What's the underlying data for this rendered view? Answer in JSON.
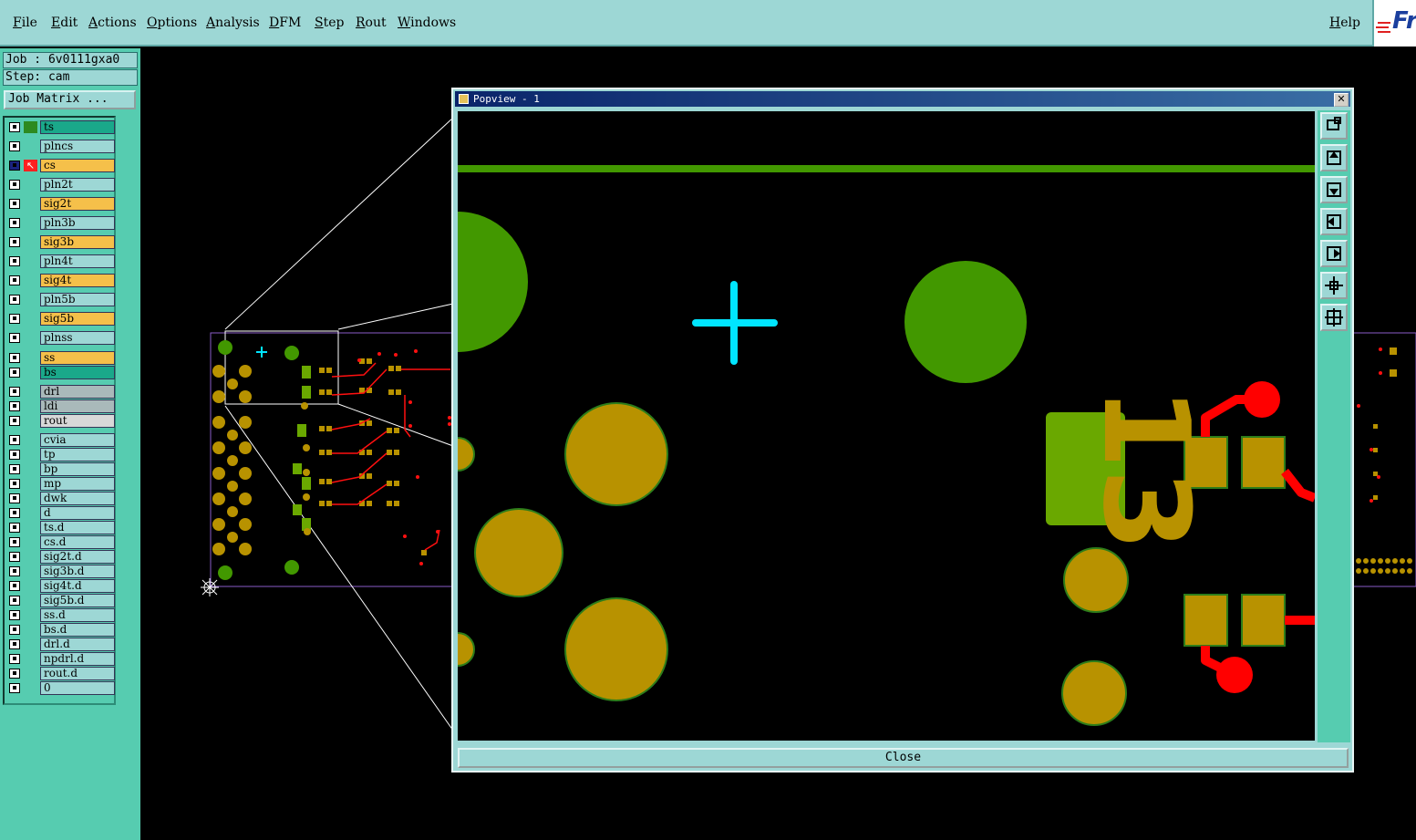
{
  "menubar": {
    "items": [
      "File",
      "Edit",
      "Actions",
      "Options",
      "Analysis",
      "DFM",
      "Step",
      "Rout",
      "Windows"
    ],
    "help": "Help",
    "logo_text": "Fr"
  },
  "sidebar": {
    "job_label": "Job : 6v0111gxa0",
    "step_label": "Step: cam",
    "job_matrix_button": "Job Matrix ...",
    "layers": [
      {
        "name": "ts",
        "color": "#1aa88a",
        "swatch": "#2d8a20"
      },
      {
        "name": "plncs",
        "color": "#9dd7d5"
      },
      {
        "name": "cs",
        "color": "#f5c04a",
        "active": true
      },
      {
        "name": "pln2t",
        "color": "#9dd7d5"
      },
      {
        "name": "sig2t",
        "color": "#f5c04a"
      },
      {
        "name": "pln3b",
        "color": "#9dd7d5"
      },
      {
        "name": "sig3b",
        "color": "#f5c04a"
      },
      {
        "name": "pln4t",
        "color": "#9dd7d5"
      },
      {
        "name": "sig4t",
        "color": "#f5c04a"
      },
      {
        "name": "pln5b",
        "color": "#9dd7d5"
      },
      {
        "name": "sig5b",
        "color": "#f5c04a"
      },
      {
        "name": "plnss",
        "color": "#9dd7d5"
      },
      {
        "name": "ss",
        "color": "#f5c04a"
      },
      {
        "name": "bs",
        "color": "#1aa88a"
      },
      {
        "name": "drl",
        "color": "#a9b9ba"
      },
      {
        "name": "ldi",
        "color": "#a9b9ba"
      },
      {
        "name": "rout",
        "color": "#d8d8d8"
      },
      {
        "name": "cvia",
        "color": "#9dd7d5"
      },
      {
        "name": "tp",
        "color": "#9dd7d5"
      },
      {
        "name": "bp",
        "color": "#9dd7d5"
      },
      {
        "name": "mp",
        "color": "#9dd7d5"
      },
      {
        "name": "dwk",
        "color": "#9dd7d5"
      },
      {
        "name": "d",
        "color": "#9dd7d5"
      },
      {
        "name": "ts.d",
        "color": "#9dd7d5"
      },
      {
        "name": "cs.d",
        "color": "#9dd7d5"
      },
      {
        "name": "sig2t.d",
        "color": "#9dd7d5"
      },
      {
        "name": "sig3b.d",
        "color": "#9dd7d5"
      },
      {
        "name": "sig4t.d",
        "color": "#9dd7d5"
      },
      {
        "name": "sig5b.d",
        "color": "#9dd7d5"
      },
      {
        "name": "ss.d",
        "color": "#9dd7d5"
      },
      {
        "name": "bs.d",
        "color": "#9dd7d5"
      },
      {
        "name": "drl.d",
        "color": "#9dd7d5"
      },
      {
        "name": "npdrl.d",
        "color": "#9dd7d5"
      },
      {
        "name": "rout.d",
        "color": "#9dd7d5"
      },
      {
        "name": "0",
        "color": "#9dd7d5"
      }
    ]
  },
  "popview": {
    "title": "Popview - 1",
    "close_x": "✕",
    "close_button": "Close",
    "silkscreen_text": "13"
  },
  "colors": {
    "pad_gold": "#b89200",
    "pad_green": "#429800",
    "trace_red": "#ff0000",
    "cursor_cyan": "#00e5ff",
    "ui_teal": "#9dd7d5"
  }
}
